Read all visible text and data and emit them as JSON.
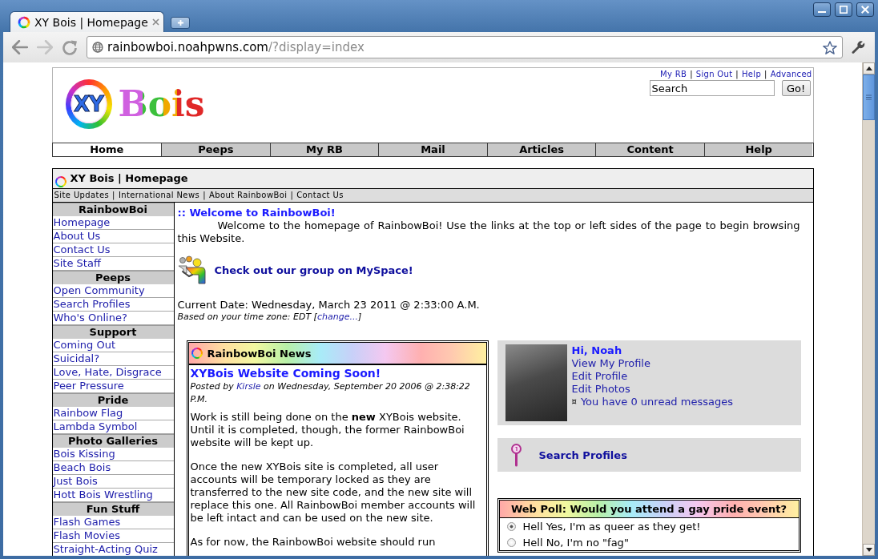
{
  "browser": {
    "tabs": [
      {
        "title": "XY Bois | Homepage",
        "selected": true
      }
    ],
    "address": {
      "host": "rainbowboi.noahpwns.com",
      "path": "/?display=index"
    }
  },
  "header": {
    "logo": {
      "mark": "XY",
      "word": "Bois"
    },
    "top_links": [
      "My RB",
      "Sign Out",
      "Help",
      "Advanced"
    ],
    "separator": "|",
    "search": {
      "value": "Search",
      "button": "Go!"
    }
  },
  "nav": [
    {
      "label": "Home",
      "selected": true
    },
    {
      "label": "Peeps",
      "selected": false
    },
    {
      "label": "My RB",
      "selected": false
    },
    {
      "label": "Mail",
      "selected": false
    },
    {
      "label": "Articles",
      "selected": false
    },
    {
      "label": "Content",
      "selected": false
    },
    {
      "label": "Help",
      "selected": false
    }
  ],
  "main": {
    "title": "XY Bois | Homepage",
    "sub_links": [
      "Site Updates",
      "International News",
      "About RainbowBoi",
      "Contact Us"
    ],
    "separator": "|"
  },
  "sidebar": {
    "sections": [
      {
        "heading": "RainbowBoi",
        "items": [
          "Homepage",
          "About Us",
          "Contact Us",
          "Site Staff"
        ]
      },
      {
        "heading": "Peeps",
        "items": [
          "Open Community",
          "Search Profiles",
          "Who's Online?"
        ]
      },
      {
        "heading": "Support",
        "items": [
          "Coming Out",
          "Suicidal?",
          "Love, Hate, Disgrace",
          "Peer Pressure"
        ]
      },
      {
        "heading": "Pride",
        "items": [
          "Rainbow Flag",
          "Lambda Symbol"
        ]
      },
      {
        "heading": "Photo Galleries",
        "items": [
          "Bois Kissing",
          "Beach Bois",
          "Just Bois",
          "Hott Bois Wrestling"
        ]
      },
      {
        "heading": "Fun Stuff",
        "items": [
          "Flash Games",
          "Flash Movies",
          "Straight-Acting Quiz"
        ]
      }
    ]
  },
  "welcome": {
    "heading": ":: Welcome to RainbowBoi!",
    "text": "Welcome to the homepage of RainbowBoi! Use the links at the top or left sides of the page to begin browsing this Website.",
    "myspace_link": "Check out our group on MySpace!",
    "current_date": "Current Date: Wednesday, March 23 2011 @ 2:33:00 A.M.",
    "timezone": {
      "before": "Based on your time zone: EDT [",
      "link": "change...",
      "after": "]"
    }
  },
  "news": {
    "title": "RainbowBoi News",
    "items": [
      {
        "headline": "XYBois Website Coming Soon!",
        "byline": {
          "before": "Posted by ",
          "author": "Kirsle",
          "after": " on Wednesday, September 20 2006 @ 2:38:22 P.M."
        },
        "paragraphs": [
          "Work is still being done on the **new** XYBois website. Until it is completed, though, the former RainbowBoi website will be kept up.",
          "Once the new XYBois site is completed, all user accounts will be temporary locked as they are transferred to the new site code, and the new site will replace this one. All RainbowBoi member accounts will be left intact and can be used on the new site.",
          "As for now, the RainbowBoi website should run"
        ]
      }
    ]
  },
  "profile": {
    "greeting": "Hi, Noah",
    "links": [
      "View My Profile",
      "Edit Profile",
      "Edit Photos"
    ],
    "messages": {
      "bullet": "¤",
      "text": "You have 0 unread messages"
    }
  },
  "search_profiles": {
    "label": "Search Profiles"
  },
  "poll": {
    "question": "Web Poll: Would you attend a gay pride event?",
    "options": [
      {
        "label": "Hell Yes, I'm as queer as they get!",
        "selected": true
      },
      {
        "label": "Hell No, I'm no \"fag\"",
        "selected": false
      }
    ]
  }
}
